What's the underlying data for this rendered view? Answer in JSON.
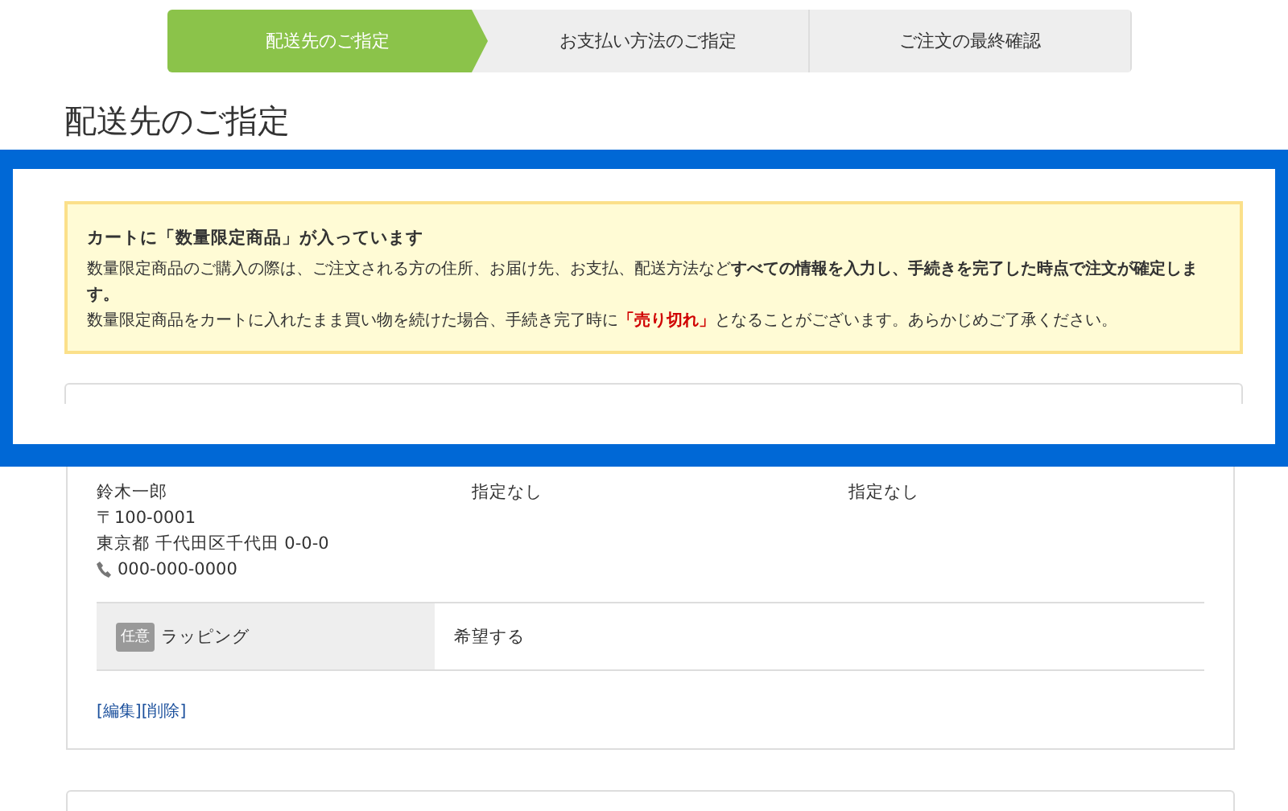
{
  "steps": [
    {
      "label": "配送先のご指定",
      "selected": true
    },
    {
      "label": "お支払い方法のご指定",
      "selected": false
    },
    {
      "label": "ご注文の最終確認",
      "selected": false
    }
  ],
  "heading": "配送先のご指定",
  "notice": {
    "title": "カートに「数量限定商品」が入っています",
    "lines": [
      "数量限定商品のご購入の際は、ご注文される方の住所、お届け先、お支払、配送方法など**すべての情報を入力し、手続きを完了した時点で注文が確定します。**",
      "数量限定商品をカートに入れたまま買い物を続けた場合、手続き完了時に"
    ],
    "highlight": "「売り切れ」",
    "tail": "となることがございます。あらかじめご了承ください。"
  },
  "address": {
    "name": "鈴木一郎",
    "postal": "〒100-0001",
    "street": "東京都 千代田区千代田 0-0-0",
    "phone": "000-000-0000"
  },
  "column_2": "指定なし",
  "column_3": "指定なし",
  "option": {
    "badge": "任意",
    "label": "ラッピング",
    "value": "希望する"
  },
  "links": [
    "[編集]",
    "[削除]"
  ]
}
